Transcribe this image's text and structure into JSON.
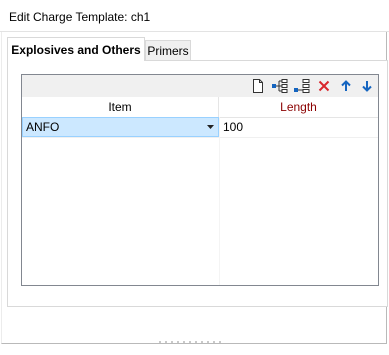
{
  "window": {
    "title": "Edit Charge Template: ch1"
  },
  "tabs": [
    {
      "label": "Explosives and Others",
      "active": true
    },
    {
      "label": "Primers",
      "active": false
    }
  ],
  "toolbar": {
    "buttons": [
      {
        "name": "new-row",
        "icon": "document-icon"
      },
      {
        "name": "insert-child",
        "icon": "tree-insert-icon"
      },
      {
        "name": "insert-row",
        "icon": "row-insert-icon"
      },
      {
        "name": "delete-row",
        "icon": "delete-x-icon"
      },
      {
        "name": "move-up",
        "icon": "arrow-up-icon"
      },
      {
        "name": "move-down",
        "icon": "arrow-down-icon"
      }
    ]
  },
  "grid": {
    "columns": [
      {
        "label": "Item"
      },
      {
        "label": "Length",
        "color": "#8b0000"
      }
    ],
    "rows": [
      {
        "item": "ANFO",
        "length": "100"
      }
    ]
  },
  "colors": {
    "selection": "#cce8ff",
    "selection_border": "#99d1ff",
    "delete": "#d9262c",
    "arrow": "#1565c0"
  }
}
